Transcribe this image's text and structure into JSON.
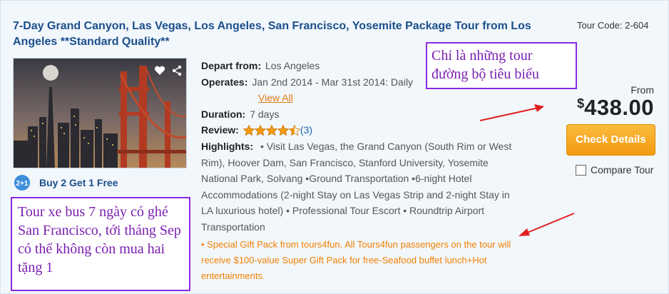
{
  "tour": {
    "title": "7-Day Grand Canyon, Las Vegas, Los Angeles, San Francisco, Yosemite Package Tour from Los Angeles **Standard Quality**",
    "tour_code": "Tour Code: 2-604"
  },
  "promo": {
    "label": "Buy 2 Get 1 Free",
    "icon_text": "2+1"
  },
  "details": {
    "depart_label": "Depart from:",
    "depart_value": "Los Angeles",
    "operates_label": "Operates:",
    "operates_value": "Jan 2nd 2014 - Mar 31st 2014: Daily",
    "view_all": "View All",
    "duration_label": "Duration:",
    "duration_value": "7 days",
    "review_label": "Review:",
    "review_rating": 4.5,
    "review_count": "(3)",
    "highlights_label": "Highlights:",
    "highlights_text": "• Visit Las Vegas, the Grand Canyon (South Rim or West Rim), Hoover Dam, San Francisco, Stanford University, Yosemite National Park, Solvang •Ground Transportation •6-night Hotel Accommodations (2-night Stay on Las Vegas Strip and 2-night Stay in LA luxurious hotel) • Professional Tour Escort • Roundtrip Airport Transportation",
    "special_text": "• Special Gift Pack from tours4fun. All Tours4fun passengers on the tour will receive $100-value Super Gift Pack for free-Seafood buffet lunch+Hot entertainments."
  },
  "pricing": {
    "from_label": "From",
    "currency": "$",
    "amount": "438.00",
    "check_button": "Check Details",
    "compare_label": "Compare Tour"
  },
  "annotations": {
    "top_note": "Chỉ là những tour đường bộ tiêu biểu",
    "bottom_note": "Tour xe bus 7 ngày có ghé San Francisco, tới tháng Sep có thể không còn mua hai tặng 1"
  },
  "icons": [
    "heart-icon",
    "share-icon",
    "star-icon",
    "buy2get1-icon"
  ],
  "colors": {
    "title": "#1b4f8a",
    "button": "#f39a10",
    "annotation": "#8a2be2",
    "arrow": "#e02020",
    "special": "#f08000"
  }
}
